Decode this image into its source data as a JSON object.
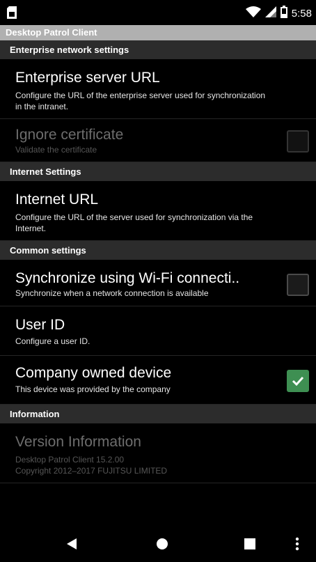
{
  "status_bar": {
    "time": "5:58",
    "icons": [
      "sim-card-icon",
      "wifi-icon",
      "signal-icon",
      "battery-icon"
    ]
  },
  "app": {
    "title": "Desktop Patrol Client"
  },
  "sections": {
    "enterprise": {
      "header": "Enterprise network settings",
      "server_url": {
        "title": "Enterprise server URL",
        "summary": "Configure the URL of the enterprise server used for synchronization in the intranet."
      },
      "ignore_certificate": {
        "title": "Ignore certificate",
        "summary": "Validate the certificate",
        "checked": false,
        "enabled": false
      }
    },
    "internet": {
      "header": "Internet Settings",
      "internet_url": {
        "title": "Internet URL",
        "summary": "Configure the URL of the server used for synchronization via the Internet."
      }
    },
    "common": {
      "header": "Common settings",
      "wifi_sync": {
        "title": "Synchronize using Wi-Fi connecti..",
        "summary": "Synchronize when a network connection is available",
        "checked": false
      },
      "user_id": {
        "title": "User ID",
        "summary": "Configure a user ID."
      },
      "company_device": {
        "title": "Company owned device",
        "summary": "This device was provided by the company",
        "checked": true
      }
    },
    "information": {
      "header": "Information",
      "version": {
        "title": "Version Information",
        "line1": "Desktop Patrol Client 15.2.00",
        "line2": "Copyright 2012–2017 FUJITSU LIMITED"
      }
    }
  },
  "colors": {
    "check_green": "#3e8f52",
    "section_header_bg": "#2c2c2c",
    "titlebar_bg": "#b0b0b0"
  }
}
